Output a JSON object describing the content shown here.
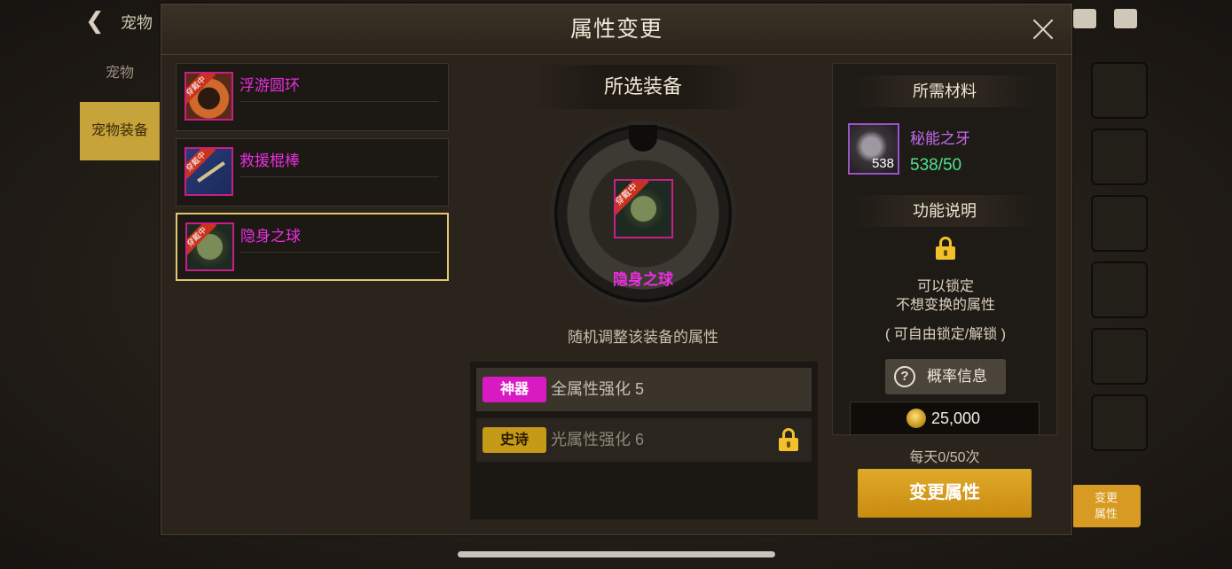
{
  "background": {
    "title": "宠物",
    "tabs": [
      "宠物",
      "宠物装备"
    ],
    "side_button": "变更\n属性"
  },
  "modal": {
    "title": "属性变更"
  },
  "items": [
    {
      "name": "浮游圆环",
      "tag": "穿戴中"
    },
    {
      "name": "救援棍棒",
      "tag": "穿戴中"
    },
    {
      "name": "隐身之球",
      "tag": "穿戴中"
    }
  ],
  "center": {
    "heading": "所选装备",
    "equip_name": "隐身之球",
    "equip_tag": "穿戴中",
    "description": "随机调整该装备的属性",
    "attributes": [
      {
        "grade": "神器",
        "text": "全属性强化 5",
        "locked": false
      },
      {
        "grade": "史诗",
        "text": "光属性强化 6",
        "locked": true
      }
    ]
  },
  "right": {
    "materials_heading": "所需材料",
    "material_name": "秘能之牙",
    "material_count": "538",
    "material_qty": "538/50",
    "feature_heading": "功能说明",
    "feature_line1": "可以锁定",
    "feature_line2": "不想变换的属性",
    "feature_line3": "( 可自由锁定/解锁 )",
    "prob_label": "概率信息",
    "cost": "25,000"
  },
  "daily": "每天0/50次",
  "change_button": "变更属性",
  "colors": {
    "accent": "#d79a23",
    "legendary_text": "#ea2fe0",
    "material_purple": "#c06bf0",
    "qty_green": "#4fe28a"
  }
}
